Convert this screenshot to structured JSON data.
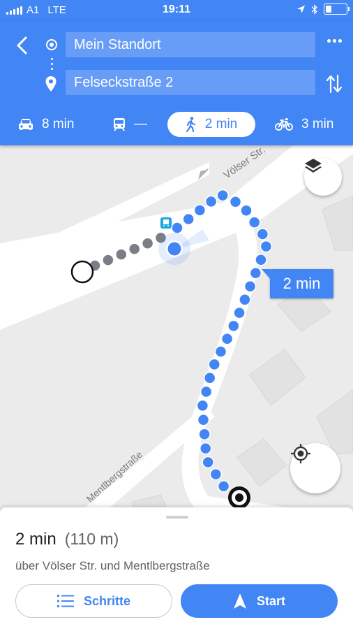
{
  "status_bar": {
    "carrier": "A1",
    "network": "LTE",
    "time": "19:11",
    "battery_level": 0.3
  },
  "header": {
    "origin": "Mein Standort",
    "destination": "Felseckstraße 2"
  },
  "modes": {
    "car": "8 min",
    "transit": "—",
    "walk": "2 min",
    "bike": "3 min",
    "selected": "walk"
  },
  "map": {
    "road_voelser": "Völser Str.",
    "road_mentl": "Mentlbergstraße",
    "route_duration": "2 min"
  },
  "sheet": {
    "duration": "2 min",
    "distance": "(110 m)",
    "via": "über Völser Str. und Mentlbergstraße",
    "steps_label": "Schritte",
    "start_label": "Start"
  },
  "colors": {
    "brand_blue": "#4285f4",
    "route_gray": "#7a7f87"
  }
}
